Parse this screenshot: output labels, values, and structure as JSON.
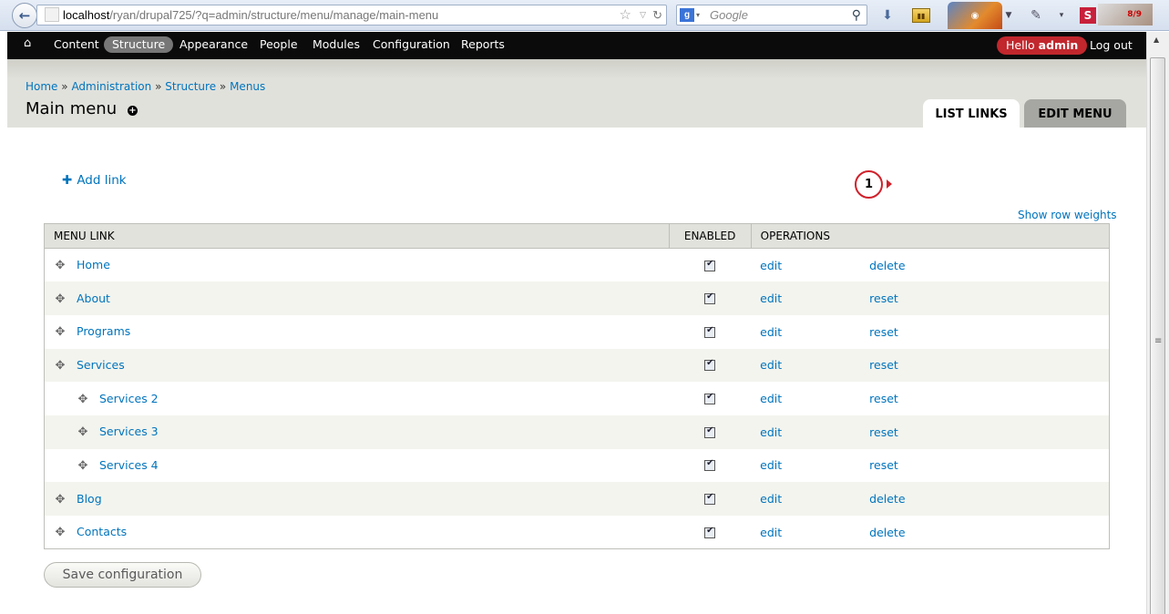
{
  "browser": {
    "url_host": "localhost",
    "url_path": "/ryan/drupal725/?q=admin/structure/menu/manage/main-menu",
    "search_placeholder": "Google",
    "addon_badge": "8/9",
    "icons": [
      "back-arrow-icon",
      "star-icon",
      "reload-icon",
      "search-icon",
      "download-icon",
      "firefox-icon",
      "pen-icon",
      "s-icon"
    ]
  },
  "toolbar": {
    "items": [
      "Content",
      "Structure",
      "Appearance",
      "People",
      "Modules",
      "Configuration",
      "Reports"
    ],
    "active": "Structure",
    "hello": "Hello",
    "user": "admin",
    "logout": "Log out"
  },
  "header": {
    "breadcrumb": [
      "Home",
      "Administration",
      "Structure",
      "Menus"
    ],
    "breadcrumb_sep": "»",
    "title": "Main menu",
    "tabs": [
      "LIST LINKS",
      "EDIT MENU"
    ]
  },
  "content": {
    "add_link": "Add link",
    "show_weights": "Show row weights",
    "columns": [
      "MENU LINK",
      "ENABLED",
      "OPERATIONS"
    ],
    "rows": [
      {
        "label": "Home",
        "indent": 0,
        "enabled": true,
        "edit": "edit",
        "op2": "delete"
      },
      {
        "label": "About",
        "indent": 0,
        "enabled": true,
        "edit": "edit",
        "op2": "reset"
      },
      {
        "label": "Programs",
        "indent": 0,
        "enabled": true,
        "edit": "edit",
        "op2": "reset"
      },
      {
        "label": "Services",
        "indent": 0,
        "enabled": true,
        "edit": "edit",
        "op2": "reset"
      },
      {
        "label": "Services 2",
        "indent": 1,
        "enabled": true,
        "edit": "edit",
        "op2": "reset"
      },
      {
        "label": "Services 3",
        "indent": 1,
        "enabled": true,
        "edit": "edit",
        "op2": "reset"
      },
      {
        "label": "Services 4",
        "indent": 1,
        "enabled": true,
        "edit": "edit",
        "op2": "reset"
      },
      {
        "label": "Blog",
        "indent": 0,
        "enabled": true,
        "edit": "edit",
        "op2": "delete"
      },
      {
        "label": "Contacts",
        "indent": 0,
        "enabled": true,
        "edit": "edit",
        "op2": "delete"
      }
    ],
    "save_button": "Save configuration"
  },
  "annotation": {
    "number": "1",
    "color": "#d0212b"
  },
  "colors": {
    "link": "#0074bd",
    "toolbar_bg": "#0b0b0b",
    "hello_pill": "#c1272d",
    "header_bg": "#e1e1dc",
    "active_tab_bg": "#ffffff",
    "inactive_tab_bg": "#a6a7a2"
  }
}
